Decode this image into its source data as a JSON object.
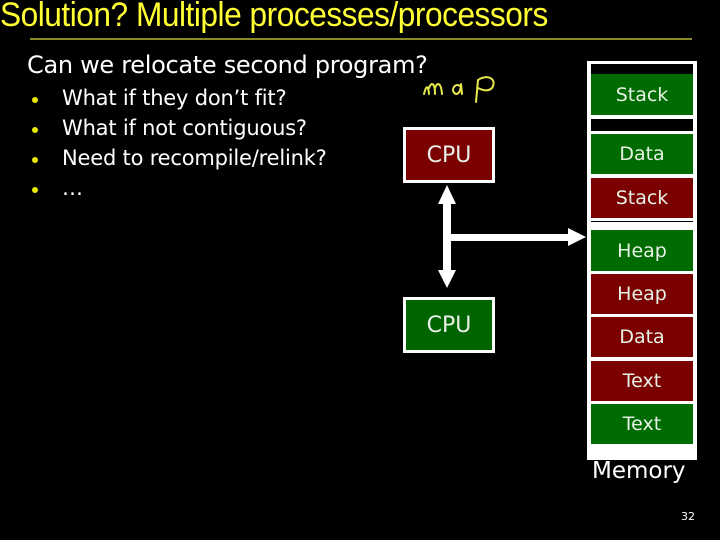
{
  "slide": {
    "title": "Solution? Multiple processes/processors",
    "subtitle": "Can we relocate second program?",
    "bullets": [
      "What if they don’t fit?",
      "What if not contiguous?",
      "Need to recompile/relink?",
      "…"
    ],
    "annotation": "map",
    "page_number": "32"
  },
  "diagram": {
    "cpus": [
      {
        "label": "CPU",
        "color": "#7b0000"
      },
      {
        "label": "CPU",
        "color": "#006400"
      }
    ],
    "memory": {
      "label": "Memory",
      "segments": [
        {
          "label": "",
          "color": "#000000"
        },
        {
          "label": "Stack",
          "color": "#006b00"
        },
        {
          "label": "",
          "color": "#000000"
        },
        {
          "label": "Data",
          "color": "#006b00"
        },
        {
          "label": "Stack",
          "color": "#7b0000"
        },
        {
          "label": "Heap",
          "color": "#006b00"
        },
        {
          "label": "Heap",
          "color": "#7b0000"
        },
        {
          "label": "Data",
          "color": "#7b0000"
        },
        {
          "label": "Text",
          "color": "#7b0000"
        },
        {
          "label": "Text",
          "color": "#006b00"
        }
      ]
    }
  },
  "colors": {
    "title": "#ffff33",
    "bullet": "#e8e800",
    "process_a": "#7b0000",
    "process_b": "#006b00"
  }
}
